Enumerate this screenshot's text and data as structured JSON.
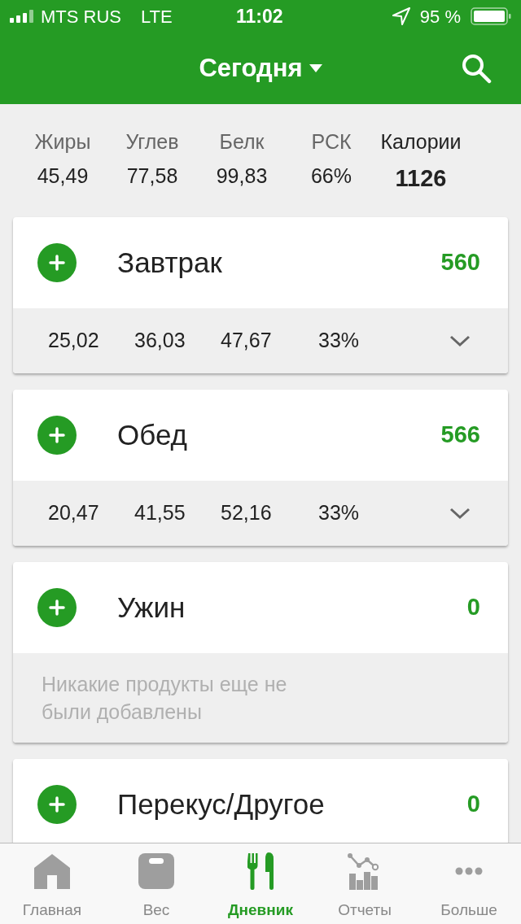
{
  "status_bar": {
    "carrier": "MTS RUS",
    "network": "LTE",
    "time": "11:02",
    "battery": "95 %"
  },
  "header": {
    "title": "Сегодня"
  },
  "summary": [
    {
      "label": "Жиры",
      "value": "45,49",
      "emphasis": false
    },
    {
      "label": "Углев",
      "value": "77,58",
      "emphasis": false
    },
    {
      "label": "Белк",
      "value": "99,83",
      "emphasis": false
    },
    {
      "label": "РСК",
      "value": "66%",
      "emphasis": false
    },
    {
      "label": "Калории",
      "value": "1126",
      "emphasis": true
    }
  ],
  "meals": [
    {
      "name": "Завтрак",
      "calories": "560",
      "macros": [
        "25,02",
        "36,03",
        "47,67",
        "33%"
      ]
    },
    {
      "name": "Обед",
      "calories": "566",
      "macros": [
        "20,47",
        "41,55",
        "52,16",
        "33%"
      ]
    },
    {
      "name": "Ужин",
      "calories": "0",
      "message": "Никакие продукты еще не были добавлены"
    },
    {
      "name": "Перекус/Другое",
      "calories": "0"
    }
  ],
  "tabs": [
    {
      "label": "Главная",
      "kind": "home",
      "selected": false
    },
    {
      "label": "Вес",
      "kind": "scale",
      "selected": false
    },
    {
      "label": "Дневник",
      "kind": "diary",
      "selected": true
    },
    {
      "label": "Отчеты",
      "kind": "reports",
      "selected": false
    },
    {
      "label": "Больше",
      "kind": "more",
      "selected": false
    }
  ]
}
